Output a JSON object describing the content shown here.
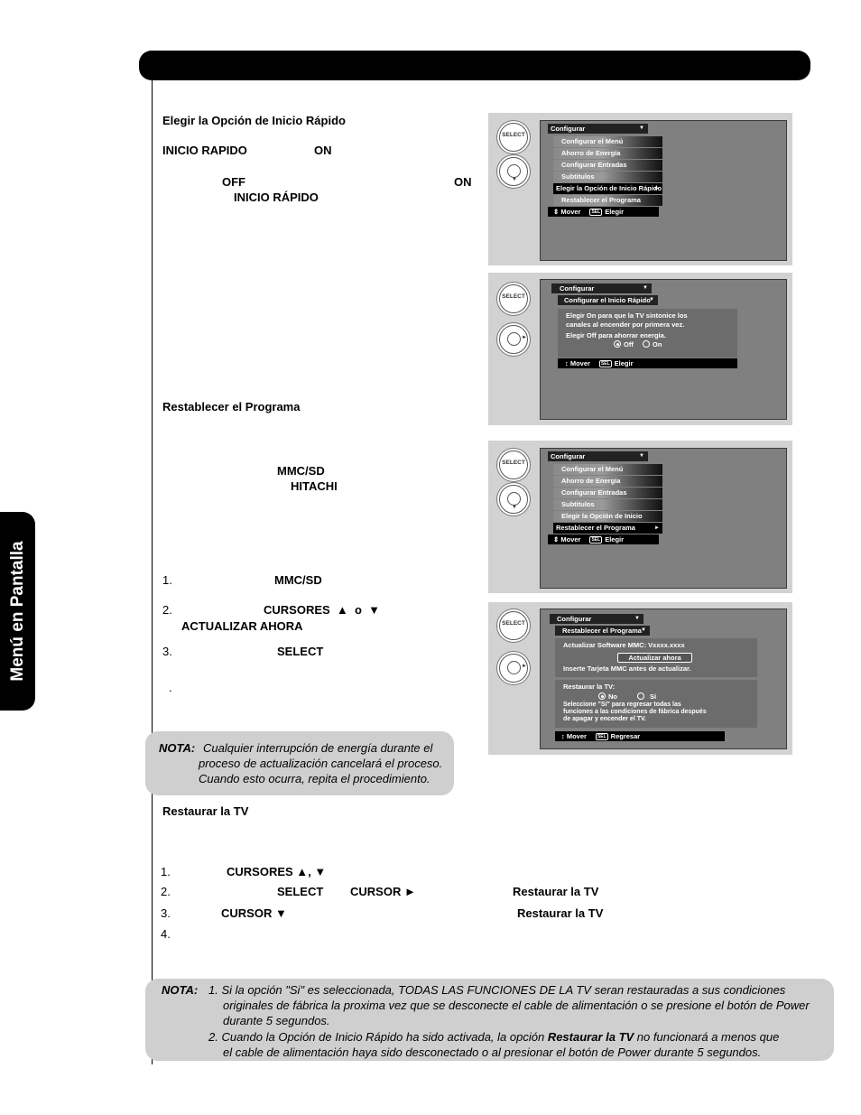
{
  "side_tab": "Menú en Pantalla",
  "section1": {
    "heading": "Elegir la Opción de Inicio Rápido",
    "line1_a": "INICIO RAPIDO",
    "line1_b": "ON",
    "line2_a": "OFF",
    "line2_b": "ON",
    "line3": "INICIO RÁPIDO"
  },
  "section2": {
    "heading": "Restablecer el Programa",
    "kw1": "MMC/SD",
    "kw2": "HITACHI",
    "steps": [
      {
        "num": "1.",
        "kw": "MMC/SD"
      },
      {
        "num": "2.",
        "kw": "CURSORES  ▲  o  ▼",
        "kw2": "ACTUALIZAR AHORA"
      },
      {
        "num": "3.",
        "kw": "SELECT"
      }
    ],
    "dot": "."
  },
  "note1": {
    "label": "NOTA:",
    "lines": [
      "Cualquier interrupción de energía durante el",
      "proceso de actualización cancelará el proceso.",
      "Cuando esto ocurra, repita el procedimiento."
    ]
  },
  "section3": {
    "heading": "Restaurar la TV",
    "steps": [
      {
        "num": "1.",
        "kw": "CURSORES ▲, ▼"
      },
      {
        "num": "2.",
        "kw": "SELECT",
        "kw2": "CURSOR ►",
        "kw3": "Restaurar la TV"
      },
      {
        "num": "3.",
        "kw": "CURSOR ▼",
        "kw3": "Restaurar la TV"
      },
      {
        "num": "4."
      }
    ]
  },
  "note2": {
    "label": "NOTA:",
    "item1_lines": [
      "1. Si la opción \"Si\" es seleccionada, TODAS LAS FUNCIONES DE LA TV seran restauradas a sus condiciones",
      "originales de fábrica la proxima vez que se desconecte el cable de alimentación o se presione el botón de Power",
      "durante 5 segundos."
    ],
    "item2_line1_pre": "2. Cuando la Opción de Inicio Rápido ha sido activada, la opción ",
    "item2_line1_bold": "Restaurar la TV",
    "item2_line1_post": " no funcionará a menos que",
    "item2_line2": "el cable de alimentación haya sido desconectado o al presionar el botón de Power durante 5 segundos."
  },
  "remote": {
    "select_label": "SELECT"
  },
  "screens": {
    "menu_title": "Configurar",
    "menu_items": [
      "Configurar el Menú",
      "Ahorro de Energía",
      "Configurar Entradas",
      "Subtitulos",
      "Elegir la Opción de Inicio Rápido",
      "Restablecer el Programa"
    ],
    "help_move": "Mover",
    "help_sel": "SEL",
    "help_choose": "Elegir",
    "help_back": "Regresar",
    "quick_start": {
      "submenu_title": "Configurar el Inicio Rápido",
      "text1": "Elegir On para que la TV sintonice los",
      "text2": "canales al encender por primera vez.",
      "text3": "Elegir Off para ahorrar energía.",
      "opt_off": "Off",
      "opt_on": "On",
      "selected": "Off"
    },
    "reset": {
      "submenu_title": "Restablecer el Programa",
      "software_label": "Actualizar Software MMC:  Vxxxx.xxxx",
      "update_button": "Actualizar ahora",
      "insert_text": "Inserte Tarjeta MMC antes de actualizar.",
      "restore_label": "Restaurar la TV:",
      "opt_no": "No",
      "opt_si": "Sí",
      "selected": "No",
      "desc1": "Seleccione \"Sí\" para regresar todas las",
      "desc2": "funciones a las condiciones de fábrica después",
      "desc3": "de apagar y encender el TV."
    }
  }
}
